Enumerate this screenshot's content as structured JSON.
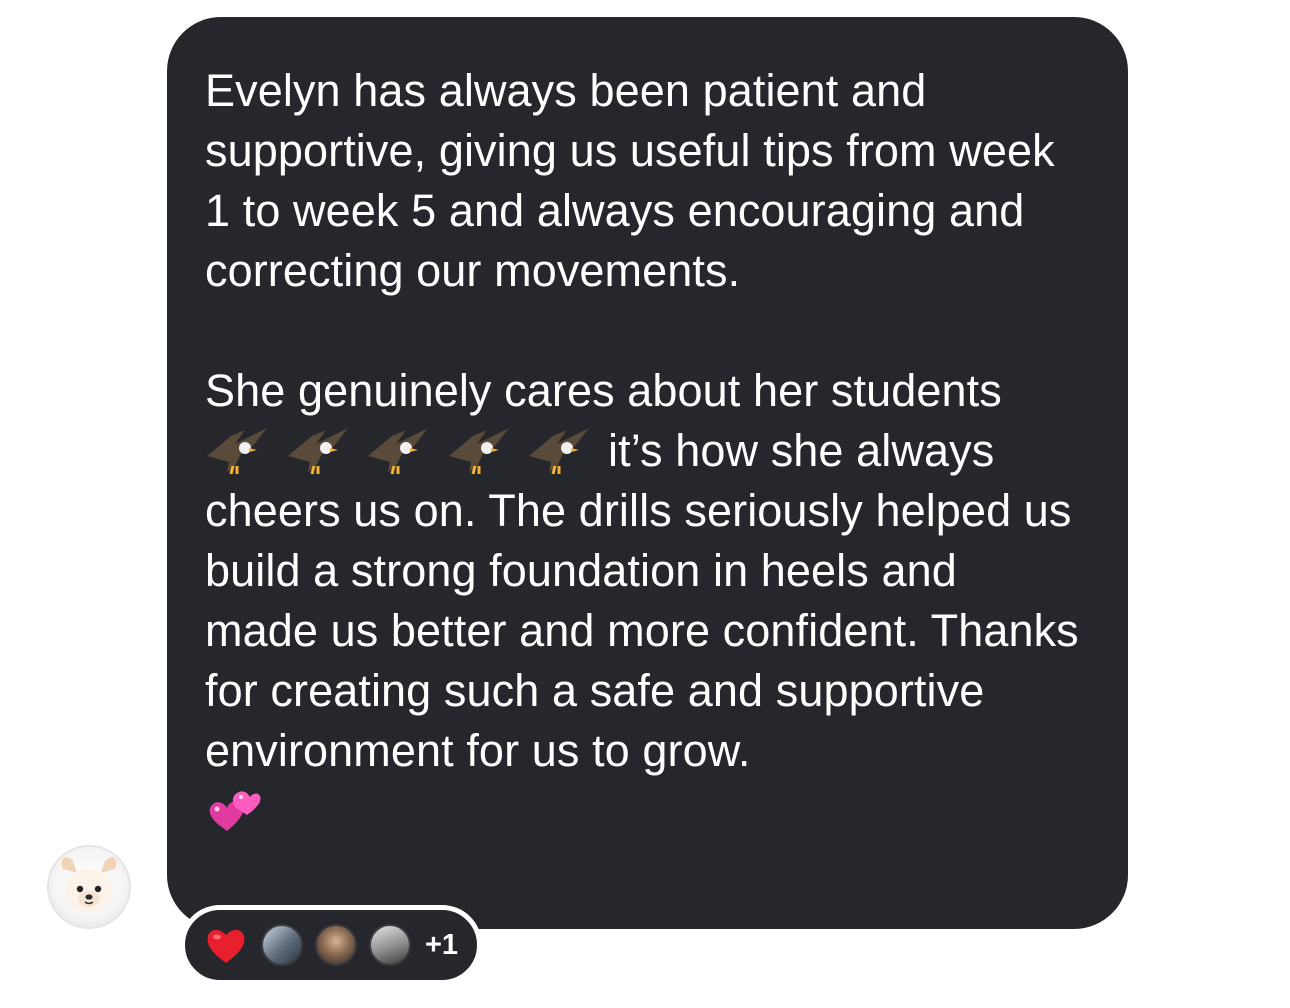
{
  "message": {
    "paragraph1": "Evelyn has always been patient and supportive, giving us useful tips from week 1 to week 5 and always encouraging and correcting our movements.",
    "paragraph2_start": "She genuinely cares about her students",
    "paragraph2_after_emoji": " it’s how she always cheers us on. The drills seriously helped us build a strong foundation in heels and made us better and more confident. Thanks for creating such a safe and supportive environment for us to grow.",
    "eagle_emoji_count": 5,
    "trailing_emoji": "two-hearts-icon"
  },
  "reactions": {
    "emoji": "red-heart-icon",
    "reactor_count_label": "+1"
  },
  "colors": {
    "bubble_bg": "#25272c",
    "text": "#ffffff",
    "page_bg": "#ffffff"
  }
}
